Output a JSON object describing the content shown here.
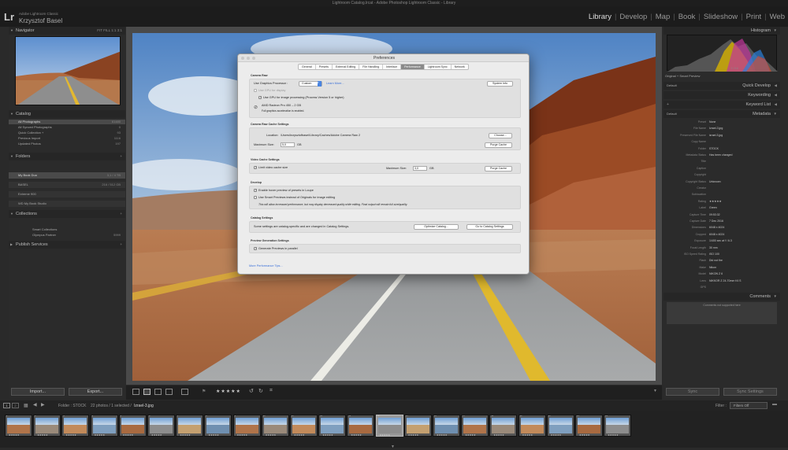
{
  "window": {
    "title": "Lightroom Catalog.lrcat - Adobe Photoshop Lightroom Classic - Library"
  },
  "identity": {
    "logo": "Lr",
    "app_name": "Adobe Lightroom Classic",
    "user": "Krzysztof Basel"
  },
  "modules": [
    {
      "label": "Library",
      "active": true
    },
    {
      "label": "Develop",
      "active": false
    },
    {
      "label": "Map",
      "active": false
    },
    {
      "label": "Book",
      "active": false
    },
    {
      "label": "Slideshow",
      "active": false
    },
    {
      "label": "Print",
      "active": false
    },
    {
      "label": "Web",
      "active": false
    }
  ],
  "left": {
    "navigator": {
      "title": "Navigator",
      "zoom": "FIT  FILL  1:1  3:1"
    },
    "catalog": {
      "title": "Catalog",
      "items": [
        {
          "label": "All Photographs",
          "count": "61480"
        },
        {
          "label": "All Synced Photographs",
          "count": "0"
        },
        {
          "label": "Quick Collection +",
          "count": "93"
        },
        {
          "label": "Previous Import",
          "count": "1116"
        },
        {
          "label": "Updated Photos",
          "count": "197"
        }
      ]
    },
    "folders": {
      "title": "Folders",
      "items": [
        {
          "label": "My Book Duo",
          "count": "3,1 / 4 TB"
        },
        {
          "label": "BASEL",
          "count": "216 / 512 GB"
        },
        {
          "label": "Extreme 900",
          "count": ""
        },
        {
          "label": "WD My Book Studio",
          "count": ""
        }
      ]
    },
    "collections": {
      "title": "Collections",
      "items": [
        {
          "label": "Smart Collections",
          "count": ""
        },
        {
          "label": "Olympus Partner",
          "count": "5999"
        }
      ]
    },
    "publish": {
      "title": "Publish Services"
    },
    "import_label": "Import...",
    "export_label": "Export..."
  },
  "right": {
    "histogram": {
      "title": "Histogram",
      "left_info": "Original + Smart Preview",
      "readout": "f / 5.6"
    },
    "quick_develop": {
      "title": "Quick Develop",
      "preset": "Default"
    },
    "keywording": {
      "title": "Keywording"
    },
    "keyword_list": {
      "title": "Keyword List"
    },
    "metadata": {
      "title": "Metadata",
      "preset_label": "Default",
      "rows": [
        {
          "label": "Preset",
          "value": "None"
        },
        {
          "label": "File Name",
          "value": "Izrael-3.jpg"
        },
        {
          "label": "Preserved File Name",
          "value": "izrael-3.jpg"
        },
        {
          "label": "Copy Name",
          "value": ""
        },
        {
          "label": "Folder",
          "value": "STOCK"
        },
        {
          "label": "Metadata Status",
          "value": "Has been changed"
        },
        {
          "label": "Title",
          "value": ""
        },
        {
          "label": "Caption",
          "value": ""
        },
        {
          "label": "Copyright",
          "value": ""
        },
        {
          "label": "Copyright Status",
          "value": "Unknown"
        },
        {
          "label": "Creator",
          "value": ""
        },
        {
          "label": "Sublocation",
          "value": ""
        },
        {
          "label": "Rating",
          "value": "★★★★★"
        },
        {
          "label": "Label",
          "value": "Green"
        },
        {
          "label": "Capture Time",
          "value": "09:53:32"
        },
        {
          "label": "Capture Date",
          "value": "7 Dec 2016"
        },
        {
          "label": "Dimensions",
          "value": "6048 x 4024"
        },
        {
          "label": "Cropped",
          "value": "6048 x 4024"
        },
        {
          "label": "Exposure",
          "value": "1/400 sec at f / 6.3"
        },
        {
          "label": "Focal Length",
          "value": "30 mm"
        },
        {
          "label": "ISO Speed Rating",
          "value": "ISO 100"
        },
        {
          "label": "Flash",
          "value": "Did not fire"
        },
        {
          "label": "Make",
          "value": "Nikon"
        },
        {
          "label": "Model",
          "value": "NIKON Z 6"
        },
        {
          "label": "Lens",
          "value": "NIKKOR Z 24-70mm f/4 S"
        },
        {
          "label": "GPS",
          "value": ""
        }
      ]
    },
    "comments": {
      "title": "Comments",
      "note": "Comments not supported here"
    },
    "sync_label": "Sync",
    "sync_settings_label": "Sync Settings"
  },
  "preferences": {
    "title": "Preferences",
    "tabs": [
      {
        "label": "General",
        "active": false
      },
      {
        "label": "Presets",
        "active": false
      },
      {
        "label": "External Editing",
        "active": false
      },
      {
        "label": "File Handling",
        "active": false
      },
      {
        "label": "Interface",
        "active": false
      },
      {
        "label": "Performance",
        "active": true
      },
      {
        "label": "Lightroom Sync",
        "active": false
      },
      {
        "label": "Network",
        "active": false
      }
    ],
    "camera_raw": {
      "title": "Camera Raw",
      "processor_label": "Use Graphics Processor :",
      "processor_value": "Custom",
      "learn_more": "Learn More...",
      "system_info": "System Info",
      "gpu_display": "Use GPU for display",
      "gpu_processing": "Use GPU for image processing (Process Version 5 or higher)",
      "gpu_name": "AMD Radeon Pro 450 – 2 GB",
      "gpu_status": "Full graphics acceleration is enabled."
    },
    "cache": {
      "title": "Camera Raw Cache Settings",
      "location_label": "Location:",
      "location_value": "/Users/krzysztofbasel/Library/Caches/Adobe Camera Raw 2",
      "choose": "Choose...",
      "max_size_label": "Maximum Size:",
      "max_size_value": "5,0",
      "unit": "GB",
      "purge": "Purge Cache"
    },
    "video": {
      "title": "Video Cache Settings",
      "limit_label": "Limit video cache size",
      "max_size_label": "Maximum Size:",
      "max_size_value": "3,0",
      "unit": "GB",
      "purge": "Purge Cache"
    },
    "develop": {
      "title": "Develop",
      "hover_label": "Enable hover preview of presets in Loupe",
      "smart_label": "Use Smart Previews instead of Originals for image editing",
      "note": "This will allow increased performance, but may display decreased quality while editing. Final output will remain full size/quality."
    },
    "catalog": {
      "title": "Catalog Settings",
      "text": "Some settings are catalog-specific and are changed in Catalog Settings.",
      "optimize": "Optimize Catalog...",
      "goto": "Go to Catalog Settings"
    },
    "preview": {
      "title": "Preview Generation Settings",
      "parallel_label": "Generate Previews in parallel"
    },
    "tips_link": "More Performance Tips..."
  },
  "filmbar": {
    "page1": "1",
    "page2": "2",
    "info": "Folder : STOCK",
    "selection": "22 photos / 1 selected /",
    "file": "Izrael-3.jpg",
    "filter_label": "Filter :",
    "filter_value": "Filters Off"
  },
  "filmstrip": {
    "count": 22,
    "selected_index": 13,
    "star_label": "★★★★★",
    "numbers": [
      "1",
      "2",
      "3",
      "4",
      "5",
      "6",
      "7",
      "8",
      "9",
      "10",
      "11",
      "12",
      "13",
      "14",
      "15",
      "16",
      "17",
      "18",
      "19",
      "20",
      "21",
      "22"
    ]
  },
  "toolbar": {
    "rating": "★★★★★"
  },
  "colors": {
    "accent": "#8a8a8a",
    "link": "#3a6fd8",
    "panel": "#2b2b2b"
  }
}
